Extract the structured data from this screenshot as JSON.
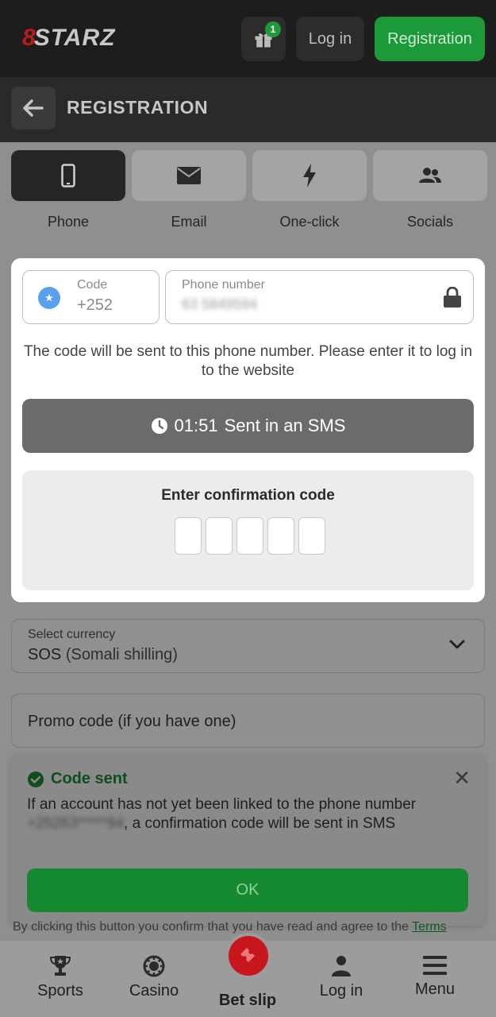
{
  "header": {
    "logo_mark": "8",
    "logo_word": "STARZ",
    "gift_badge": "1",
    "login_label": "Log in",
    "register_label": "Registration"
  },
  "subheader": {
    "title": "REGISTRATION"
  },
  "tabs": [
    {
      "label": "Phone",
      "icon": "phone-icon",
      "active": true
    },
    {
      "label": "Email",
      "icon": "envelope-icon",
      "active": false
    },
    {
      "label": "One-click",
      "icon": "lightning-icon",
      "active": false
    },
    {
      "label": "Socials",
      "icon": "people-icon",
      "active": false
    }
  ],
  "form": {
    "code_label": "Code",
    "code_value": "+252",
    "phone_label": "Phone number",
    "phone_value": "63 5849594",
    "info": "The code will be sent to this phone number. Please enter it to log in to the website",
    "timer": "01:51",
    "sms_text": "Sent in an SMS",
    "confirm_title": "Enter confirmation code",
    "digit_count": 5
  },
  "currency": {
    "label": "Select currency",
    "code": "SOS",
    "name": "(Somali shilling)"
  },
  "promo": {
    "placeholder": "Promo code (if you have one)"
  },
  "toast": {
    "title": "Code sent",
    "body_pre": "If an account has not yet been linked to the phone number ",
    "masked_number": "+25263*****94",
    "body_post": ", a confirmation code will be sent in SMS",
    "ok_label": "OK"
  },
  "terms": {
    "text": "By clicking this button you confirm that you have read and agree to the ",
    "link": "Terms"
  },
  "bottom_nav": {
    "sports": "Sports",
    "casino": "Casino",
    "betslip": "Bet slip",
    "login": "Log in",
    "menu": "Menu"
  },
  "colors": {
    "brand_green": "#1c9a3a",
    "brand_red": "#c8161d",
    "header_bg": "#1d1d1d"
  }
}
